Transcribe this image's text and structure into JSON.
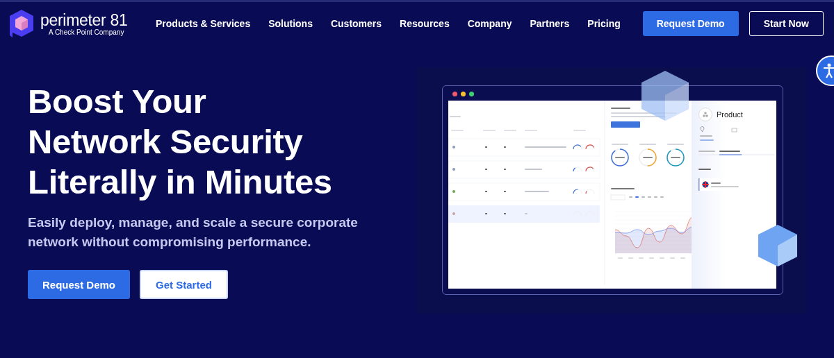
{
  "header": {
    "logo": {
      "name": "perimeter 81",
      "tagline": "A Check Point Company"
    },
    "nav": [
      {
        "label": "Products & Services"
      },
      {
        "label": "Solutions"
      },
      {
        "label": "Customers"
      },
      {
        "label": "Resources"
      },
      {
        "label": "Company"
      },
      {
        "label": "Partners"
      },
      {
        "label": "Pricing"
      }
    ],
    "buttons": [
      {
        "label": "Request Demo",
        "kind": "primary"
      },
      {
        "label": "Start Now",
        "kind": "outline"
      }
    ]
  },
  "hero": {
    "title_lines": [
      "Boost Your",
      "Network Security",
      "Literally in Minutes"
    ],
    "subtitle": "Easily deploy, manage, and scale a secure corporate network without compromising performance.",
    "buttons": [
      {
        "label": "Request Demo",
        "kind": "primary"
      },
      {
        "label": "Get Started",
        "kind": "secondary"
      }
    ]
  },
  "dashboard": {
    "window_dots": [
      {
        "color": "#ef5a6f"
      },
      {
        "color": "#f5c230"
      },
      {
        "color": "#3fcf72"
      }
    ],
    "product_title": "Product"
  }
}
